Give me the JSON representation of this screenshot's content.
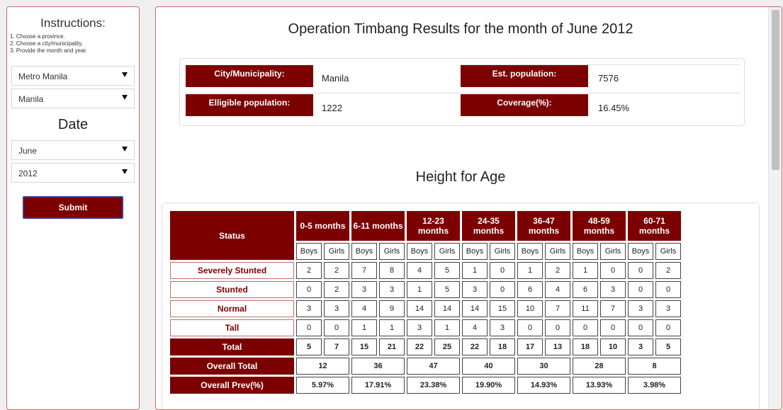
{
  "sidebar": {
    "instructions_title": "Instructions:",
    "instructions": [
      "1. Choose a province.",
      "2. Choose a city/municipality.",
      "3. Provide the month and year."
    ],
    "province_value": "Metro Manila",
    "city_value": "Manila",
    "date_title": "Date",
    "month_value": "June",
    "year_value": "2012",
    "submit_label": "Submit"
  },
  "main": {
    "title": "Operation Timbang Results for the month of June 2012",
    "info": {
      "city_label": "City/Municipality:",
      "city_value": "Manila",
      "est_pop_label": "Est. population:",
      "est_pop_value": "7576",
      "elligible_label": "Elligible population:",
      "elligible_value": "1222",
      "coverage_label": "Coverage(%):",
      "coverage_value": "16.45%"
    },
    "section_title": "Height for Age",
    "table": {
      "status_header": "Status",
      "age_groups": [
        "0-5 months",
        "6-11 months",
        "12-23 months",
        "24-35 months",
        "36-47 months",
        "48-59 months",
        "60-71 months"
      ],
      "boys_label": "Boys",
      "girls_label": "Girls",
      "rows": [
        {
          "label": "Severely Stunted",
          "values": [
            "2",
            "2",
            "7",
            "8",
            "4",
            "5",
            "1",
            "0",
            "1",
            "2",
            "1",
            "0",
            "0",
            "2"
          ]
        },
        {
          "label": "Stunted",
          "values": [
            "0",
            "2",
            "3",
            "3",
            "1",
            "5",
            "3",
            "0",
            "6",
            "4",
            "6",
            "3",
            "0",
            "0"
          ]
        },
        {
          "label": "Normal",
          "values": [
            "3",
            "3",
            "4",
            "9",
            "14",
            "14",
            "14",
            "15",
            "10",
            "7",
            "11",
            "7",
            "3",
            "3"
          ]
        },
        {
          "label": "Tall",
          "values": [
            "0",
            "0",
            "1",
            "1",
            "3",
            "1",
            "4",
            "3",
            "0",
            "0",
            "0",
            "0",
            "0",
            "0"
          ]
        }
      ],
      "total": {
        "label": "Total",
        "values": [
          "5",
          "7",
          "15",
          "21",
          "22",
          "25",
          "22",
          "18",
          "17",
          "13",
          "18",
          "10",
          "3",
          "5"
        ]
      },
      "overall_total": {
        "label": "Overall Total",
        "values": [
          "12",
          "36",
          "47",
          "40",
          "30",
          "28",
          "8"
        ]
      },
      "overall_prev": {
        "label": "Overall Prev(%)",
        "values": [
          "5.97%",
          "17.91%",
          "23.38%",
          "19.90%",
          "14.93%",
          "13.93%",
          "3.98%"
        ]
      }
    }
  }
}
